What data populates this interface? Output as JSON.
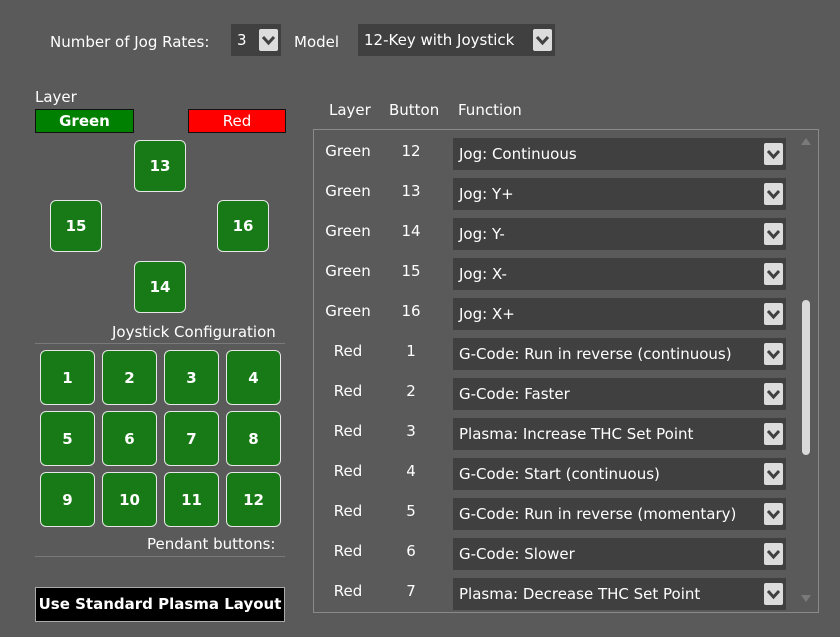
{
  "top": {
    "jog_rates_label": "Number of Jog Rates:",
    "jog_rates_value": "3",
    "model_label": "Model",
    "model_value": "12-Key with Joystick"
  },
  "layer": {
    "label": "Layer",
    "green_label": "Green",
    "red_label": "Red",
    "colors": {
      "green": "#008000",
      "red": "#ff0000"
    }
  },
  "joystick": {
    "up": "13",
    "left": "15",
    "right": "16",
    "down": "14",
    "caption": "Joystick Configuration"
  },
  "pendant": {
    "keys": [
      "1",
      "2",
      "3",
      "4",
      "5",
      "6",
      "7",
      "8",
      "9",
      "10",
      "11",
      "12"
    ],
    "caption": "Pendant buttons:"
  },
  "standard_button": "Use Standard Plasma Layout",
  "table": {
    "headers": {
      "layer": "Layer",
      "button": "Button",
      "function": "Function"
    },
    "rows": [
      {
        "layer": "Green",
        "button": "12",
        "function": "Jog: Continuous"
      },
      {
        "layer": "Green",
        "button": "13",
        "function": "Jog: Y+"
      },
      {
        "layer": "Green",
        "button": "14",
        "function": "Jog: Y-"
      },
      {
        "layer": "Green",
        "button": "15",
        "function": "Jog: X-"
      },
      {
        "layer": "Green",
        "button": "16",
        "function": "Jog: X+"
      },
      {
        "layer": "Red",
        "button": "1",
        "function": "G-Code: Run in reverse (continuous)"
      },
      {
        "layer": "Red",
        "button": "2",
        "function": "G-Code: Faster"
      },
      {
        "layer": "Red",
        "button": "3",
        "function": "Plasma: Increase THC Set Point"
      },
      {
        "layer": "Red",
        "button": "4",
        "function": "G-Code: Start (continuous)"
      },
      {
        "layer": "Red",
        "button": "5",
        "function": "G-Code: Run in reverse (momentary)"
      },
      {
        "layer": "Red",
        "button": "6",
        "function": "G-Code: Slower"
      },
      {
        "layer": "Red",
        "button": "7",
        "function": "Plasma: Decrease THC Set Point"
      }
    ]
  }
}
